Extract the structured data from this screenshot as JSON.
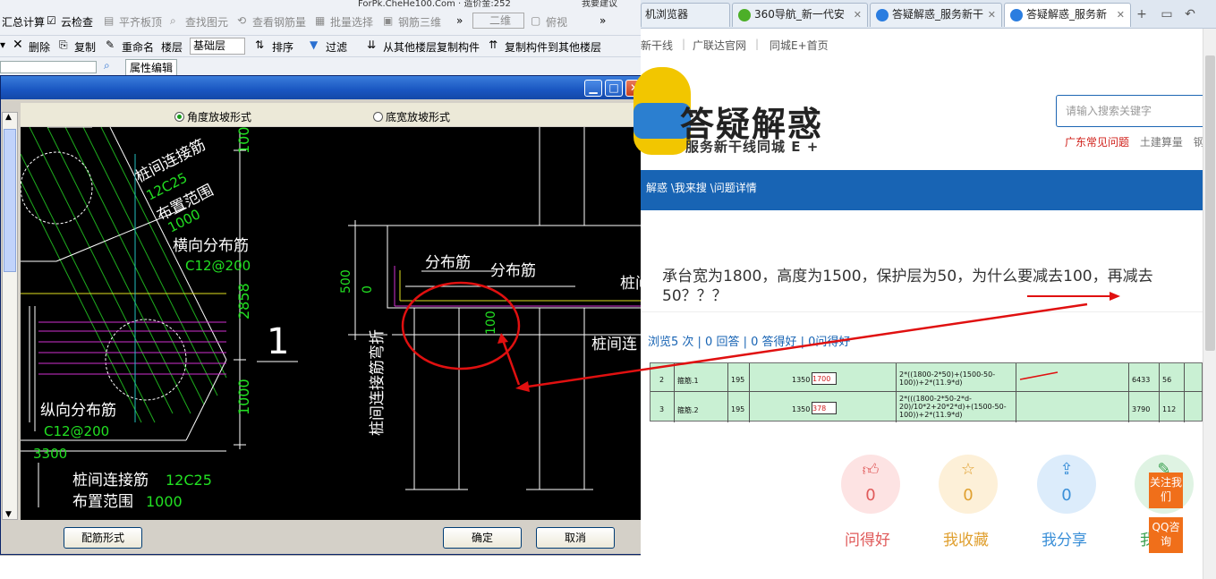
{
  "cad": {
    "toolbar_top_text": "ForPk.CheHe100.Com  · 造价金:252",
    "toolbar_top_right": "我要建议",
    "toolbar1": [
      {
        "label": "汇总计算",
        "disabled": false
      },
      {
        "label": "云检查",
        "disabled": false
      },
      {
        "label": "平齐板顶",
        "disabled": true
      },
      {
        "label": "查找图元",
        "disabled": true
      },
      {
        "label": "查看钢筋量",
        "disabled": true
      },
      {
        "label": "批量选择",
        "disabled": true
      },
      {
        "label": "钢筋三维",
        "disabled": true
      },
      {
        "label": "»",
        "disabled": false
      },
      {
        "label": "二维",
        "disabled": true
      },
      {
        "label": "俯视",
        "disabled": true
      },
      {
        "label": "»",
        "disabled": false
      }
    ],
    "toolbar2": [
      "删除",
      "复制",
      "重命名",
      "楼层",
      "基础层",
      "排序",
      "过滤",
      "从其他楼层复制构件",
      "复制构件到其他楼层"
    ],
    "prop_tab": "属性编辑",
    "dialog": {
      "radio_angle": "角度放坡形式",
      "radio_width": "底宽放坡形式",
      "btn_rebar_form": "配筋形式",
      "btn_ok": "确定",
      "btn_cancel": "取消",
      "drawing": {
        "pile_link_rebar": "桩间连接筋",
        "pile_link_spec": "12C25",
        "layout_range": "布置范围",
        "layout_value": "1000",
        "horizontal_dist": "横向分布筋",
        "horizontal_spec": "C12@200",
        "vertical_dist": "纵向分布筋",
        "vertical_spec": "C12@200",
        "dim_3300": "3300",
        "dim_100_top": "100",
        "dim_2858": "2858",
        "dim_1000": "1000",
        "section_1": "1",
        "bottom_label1": "桩间连接筋",
        "bottom_spec1": "12C25",
        "bottom_label2": "布置范围",
        "bottom_value2": "1000",
        "section_dist1": "分布筋",
        "section_dist2": "分布筋",
        "section_pile": "桩间",
        "section_pile2": "桩间连",
        "section_bent": "桩间连接筋弯折",
        "dim_500": "500",
        "dim_0": "0",
        "dim_100": "100"
      }
    }
  },
  "browser": {
    "tabs": [
      {
        "label": "机浏览器",
        "active": false
      },
      {
        "label": "360导航_新一代安",
        "active": false
      },
      {
        "label": "答疑解惑_服务新干",
        "active": false
      },
      {
        "label": "答疑解惑_服务新",
        "active": true
      }
    ],
    "toplinks": [
      "新干线",
      "广联达官网",
      "同城E+首页"
    ],
    "logo_title": "答疑解惑",
    "logo_sub": "服务新干线同城 E +",
    "search_placeholder": "请输入搜索关键字",
    "hotlinks": [
      "广东常见问题",
      "土建算量",
      "钢"
    ],
    "breadcrumb": "解惑 \\我来搜 \\问题详情",
    "question": "承台宽为1800，高度为1500，保护层为50，为什么要减去100，再减去50？？？",
    "stats": "浏览5 次 | 0 回答 | 0 答得好 | 0问得好",
    "embed_rows": [
      {
        "no": "2",
        "name": "箍筋.1",
        "dia": "195",
        "len": "1350",
        "shape": "1700",
        "formula": "2*((1800-2*50)+(1500-50-100))+2*(11.9*d)",
        "total": "6433",
        "count": "56"
      },
      {
        "no": "3",
        "name": "箍筋.2",
        "dia": "195",
        "len": "1350",
        "shape": "378",
        "formula": "2*(((1800-2*50-2*d-20)/10*2+20*2*d)+(1500-50-100))+2*(11.9*d)",
        "total": "3790",
        "count": "112"
      }
    ],
    "actions": [
      {
        "label": "问得好",
        "count": "0",
        "color": "#e05a5a",
        "bg": "#fde3e3",
        "icon": "thumb-icon"
      },
      {
        "label": "我收藏",
        "count": "0",
        "color": "#e0a030",
        "bg": "#fdf0d8",
        "icon": "star-icon"
      },
      {
        "label": "我分享",
        "count": "0",
        "color": "#3a8fd8",
        "bg": "#dcecfb",
        "icon": "share-icon"
      },
      {
        "label": "我",
        "count": "0",
        "color": "#3aa050",
        "bg": "#dff3e3",
        "icon": "report-icon"
      }
    ],
    "follow_btn": "关注我们",
    "qq_btn": "QQ咨询"
  },
  "colors": {
    "nav_blue": "#1864b4",
    "cad_green": "#22e022",
    "cad_white": "#ffffff",
    "annot_red": "#e01010"
  }
}
